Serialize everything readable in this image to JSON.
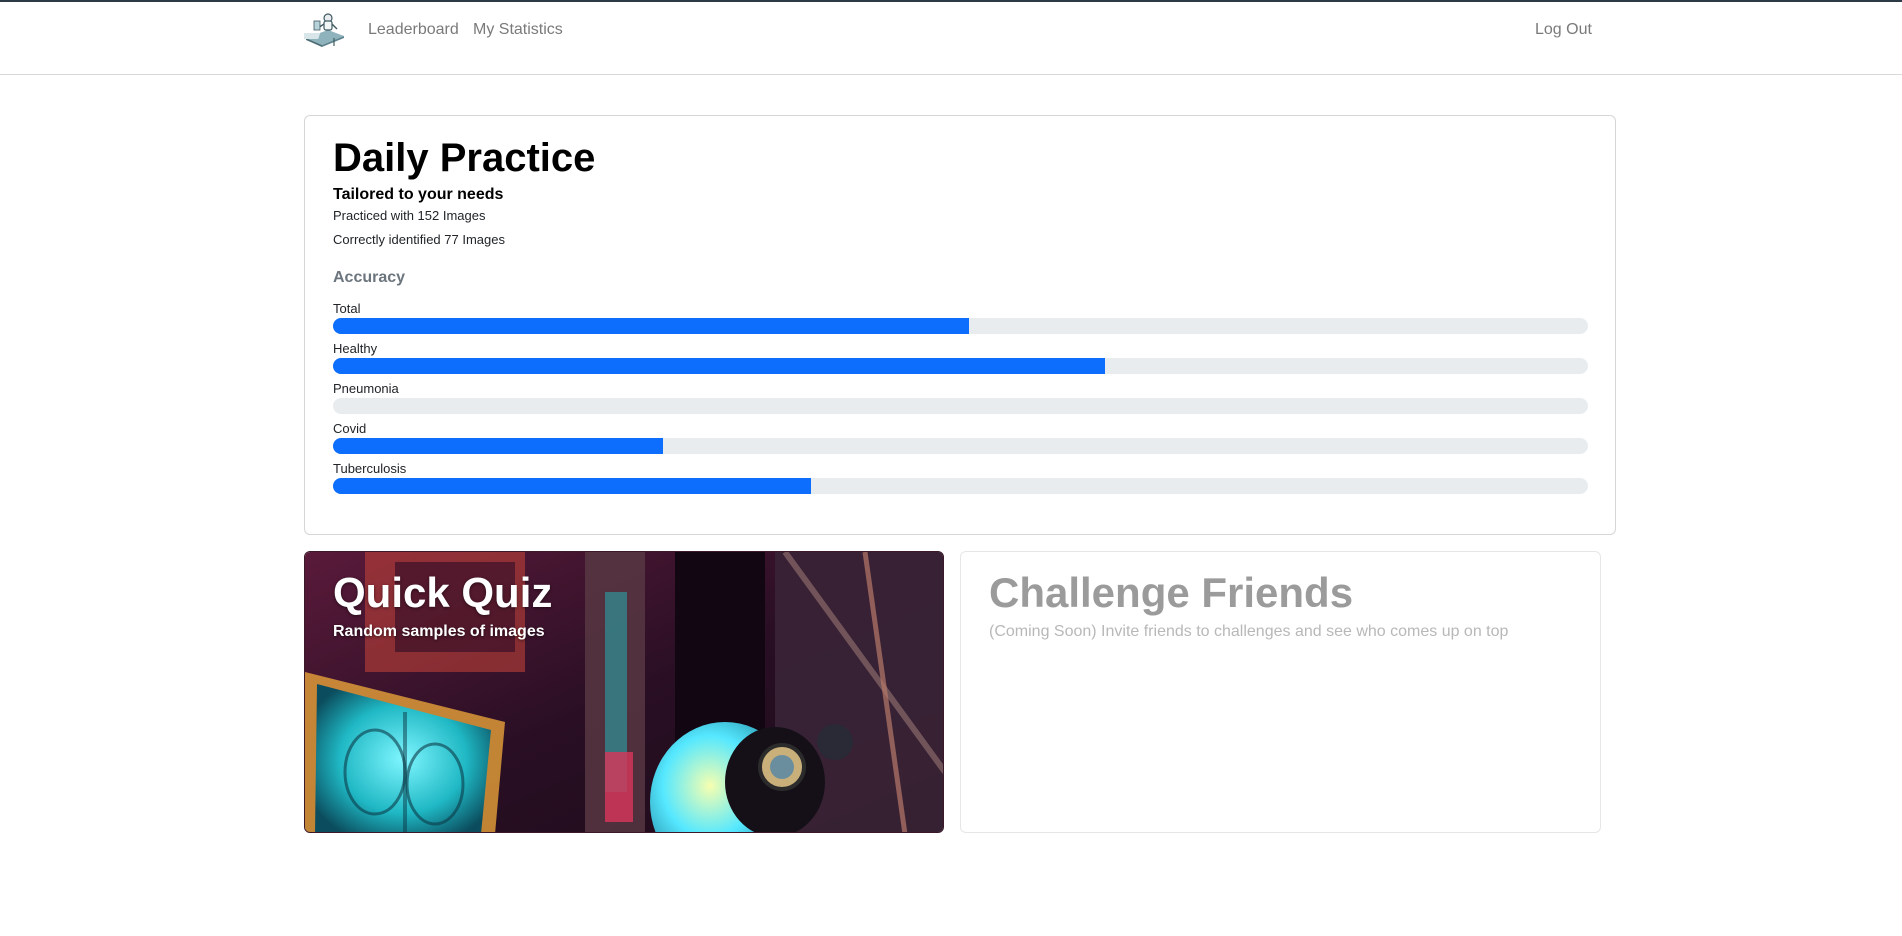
{
  "nav": {
    "links": [
      "Leaderboard",
      "My Statistics"
    ],
    "logout_label": "Log Out",
    "logo_icon": "doctor-at-desk-logo-icon"
  },
  "daily_practice": {
    "title": "Daily Practice",
    "subtitle": "Tailored to your needs",
    "practiced": "Practiced with 152 Images",
    "correct": "Correctly identified 77 Images",
    "accuracy_heading": "Accuracy",
    "accuracy": [
      {
        "label": "Total",
        "percent": 50.7
      },
      {
        "label": "Healthy",
        "percent": 61.5
      },
      {
        "label": "Pneumonia",
        "percent": 0
      },
      {
        "label": "Covid",
        "percent": 26.3
      },
      {
        "label": "Tuberculosis",
        "percent": 38.1
      }
    ],
    "bar_color": "#0d6efd",
    "track_color": "#e9ecef"
  },
  "quick_quiz": {
    "title": "Quick Quiz",
    "subtitle": "Random samples of images"
  },
  "challenge_friends": {
    "title": "Challenge Friends",
    "subtitle": "(Coming Soon) Invite friends to challenges and see who comes up on top"
  }
}
